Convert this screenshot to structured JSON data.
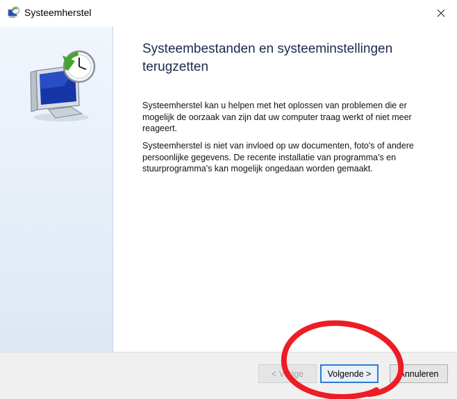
{
  "window": {
    "title": "Systeemherstel",
    "close_icon": "close-icon",
    "app_icon": "system-restore-icon"
  },
  "content": {
    "heading_line1": "Systeembestanden en systeeminstellingen",
    "heading_line2": "terugzetten",
    "paragraph1": "Systeemherstel kan u helpen met het oplossen van problemen die er mogelijk de oorzaak van zijn dat uw computer traag werkt of niet meer reageert.",
    "paragraph2": "Systeemherstel is niet van invloed op uw documenten, foto's of andere persoonlijke gegevens. De recente installatie van programma's en stuurprogramma's kan mogelijk ongedaan worden gemaakt."
  },
  "buttons": {
    "back": "< Vorige",
    "next": "Volgende >",
    "cancel": "Annuleren"
  },
  "colors": {
    "accent": "#2d7ad3",
    "annotation": "#ee1c24"
  }
}
